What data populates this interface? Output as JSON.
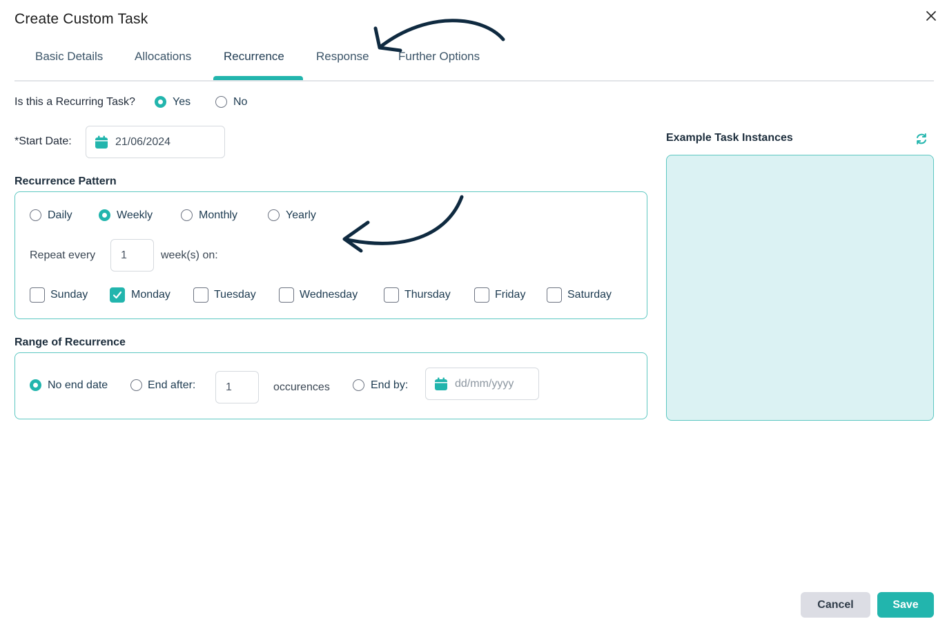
{
  "dialog": {
    "title": "Create Custom Task"
  },
  "tabs": [
    {
      "label": "Basic Details"
    },
    {
      "label": "Allocations"
    },
    {
      "label": "Recurrence",
      "active": true
    },
    {
      "label": "Response"
    },
    {
      "label": "Further Options"
    }
  ],
  "recurring": {
    "question": "Is this a Recurring Task?",
    "yes_label": "Yes",
    "no_label": "No",
    "selected": "Yes"
  },
  "start_date": {
    "label": "*Start Date:",
    "value": "21/06/2024",
    "icon": "calendar-icon"
  },
  "pattern": {
    "heading": "Recurrence Pattern",
    "options": [
      "Daily",
      "Weekly",
      "Monthly",
      "Yearly"
    ],
    "selected": "Weekly",
    "repeat_label": "Repeat every",
    "repeat_value": "1",
    "repeat_suffix": "week(s) on:",
    "days": [
      {
        "label": "Sunday",
        "checked": false
      },
      {
        "label": "Monday",
        "checked": true
      },
      {
        "label": "Tuesday",
        "checked": false
      },
      {
        "label": "Wednesday",
        "checked": false
      },
      {
        "label": "Thursday",
        "checked": false
      },
      {
        "label": "Friday",
        "checked": false
      },
      {
        "label": "Saturday",
        "checked": false
      }
    ]
  },
  "range": {
    "heading": "Range of Recurrence",
    "no_end_label": "No end date",
    "end_after_label": "End after:",
    "end_after_value": "1",
    "occurrences_label": "occurences",
    "end_by_label": "End by:",
    "end_by_placeholder": "dd/mm/yyyy",
    "selected": "No end date"
  },
  "preview": {
    "heading": "Example Task Instances",
    "refresh_icon": "refresh-icon"
  },
  "footer": {
    "cancel_label": "Cancel",
    "save_label": "Save"
  },
  "colors": {
    "accent": "#22b5ad",
    "preview_bg": "#dbf2f3",
    "annotation_arrow": "#0f2a40"
  }
}
